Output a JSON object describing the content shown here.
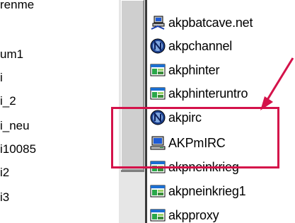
{
  "left_list": {
    "items": [
      "renme",
      "um1",
      "i",
      "i_2",
      "i_neu",
      "i10085",
      "i2",
      "i3"
    ]
  },
  "right_list": {
    "items": [
      {
        "label": "akpbatcave.net",
        "icon": "network-computer-icon"
      },
      {
        "label": "akpchannel",
        "icon": "netscape-n-icon"
      },
      {
        "label": "akphinter",
        "icon": "application-icon"
      },
      {
        "label": "akphinteruntro",
        "icon": "application-icon"
      },
      {
        "label": "akpirc",
        "icon": "netscape-n-icon"
      },
      {
        "label": "AKPmIRC",
        "icon": "computer-icon"
      },
      {
        "label": "akpneinkrieg",
        "icon": "application-icon"
      },
      {
        "label": "akpneinkrieg1",
        "icon": "application-icon"
      },
      {
        "label": "akpproxy",
        "icon": "application-icon"
      }
    ]
  },
  "annotation": {
    "highlight_color": "#d4124a",
    "arrow_color": "#d4124a"
  }
}
